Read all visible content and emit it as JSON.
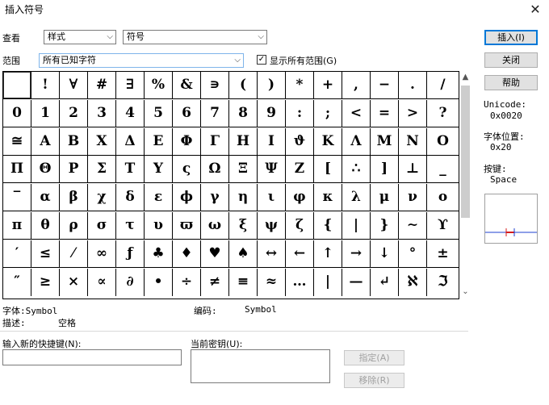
{
  "window": {
    "title": "插入符号"
  },
  "toolbar": {
    "view_label": "查看",
    "view_value": "样式",
    "font_value": "符号",
    "range_label": "范围",
    "range_value": "所有已知字符",
    "show_all_label": "显示所有范围(G)",
    "show_all_checked": true
  },
  "buttons": {
    "insert": "插入(I)",
    "close": "关闭",
    "help": "帮助",
    "assign": "指定(A)",
    "remove": "移除(R)"
  },
  "info": {
    "unicode_label": "Unicode:",
    "unicode_value": "0x0020",
    "font_pos_label": "字体位置:",
    "font_pos_value": "0x20",
    "key_label": "按键:",
    "key_value": "Space"
  },
  "status": {
    "font_label": "字体:",
    "font_value": "Symbol",
    "encoding_label": "编码:",
    "encoding_value": "Symbol",
    "desc_label": "描述:",
    "desc_value": "空格"
  },
  "shortcut": {
    "new_label": "输入新的快捷键(N):",
    "current_label": "当前密钥(U):"
  },
  "symbol_rows": [
    [
      " ",
      "!",
      "∀",
      "#",
      "∃",
      "%",
      "&",
      "∍",
      "(",
      ")",
      "*",
      "+",
      ",",
      "−",
      ".",
      "/"
    ],
    [
      "0",
      "1",
      "2",
      "3",
      "4",
      "5",
      "6",
      "7",
      "8",
      "9",
      ":",
      ";",
      "<",
      "=",
      ">",
      "?"
    ],
    [
      "≅",
      "Α",
      "Β",
      "Χ",
      "Δ",
      "Ε",
      "Φ",
      "Γ",
      "Η",
      "Ι",
      "ϑ",
      "Κ",
      "Λ",
      "Μ",
      "Ν",
      "Ο"
    ],
    [
      "Π",
      "Θ",
      "Ρ",
      "Σ",
      "Τ",
      "Υ",
      "ς",
      "Ω",
      "Ξ",
      "Ψ",
      "Ζ",
      "[",
      "∴",
      "]",
      "⊥",
      "_"
    ],
    [
      "‾",
      "α",
      "β",
      "χ",
      "δ",
      "ε",
      "ϕ",
      "γ",
      "η",
      "ι",
      "φ",
      "κ",
      "λ",
      "μ",
      "ν",
      "ο"
    ],
    [
      "π",
      "θ",
      "ρ",
      "σ",
      "τ",
      "υ",
      "ϖ",
      "ω",
      "ξ",
      "ψ",
      "ζ",
      "{",
      "|",
      "}",
      "∼",
      "ϒ"
    ],
    [
      "′",
      "≤",
      "⁄",
      "∞",
      "ƒ",
      "♣",
      "♦",
      "♥",
      "♠",
      "↔",
      "←",
      "↑",
      "→",
      "↓",
      "°",
      "±"
    ],
    [
      "″",
      "≥",
      "×",
      "∝",
      "∂",
      "•",
      "÷",
      "≠",
      "≡",
      "≈",
      "…",
      "|",
      "—",
      "↵",
      "ℵ",
      "ℑ"
    ]
  ]
}
